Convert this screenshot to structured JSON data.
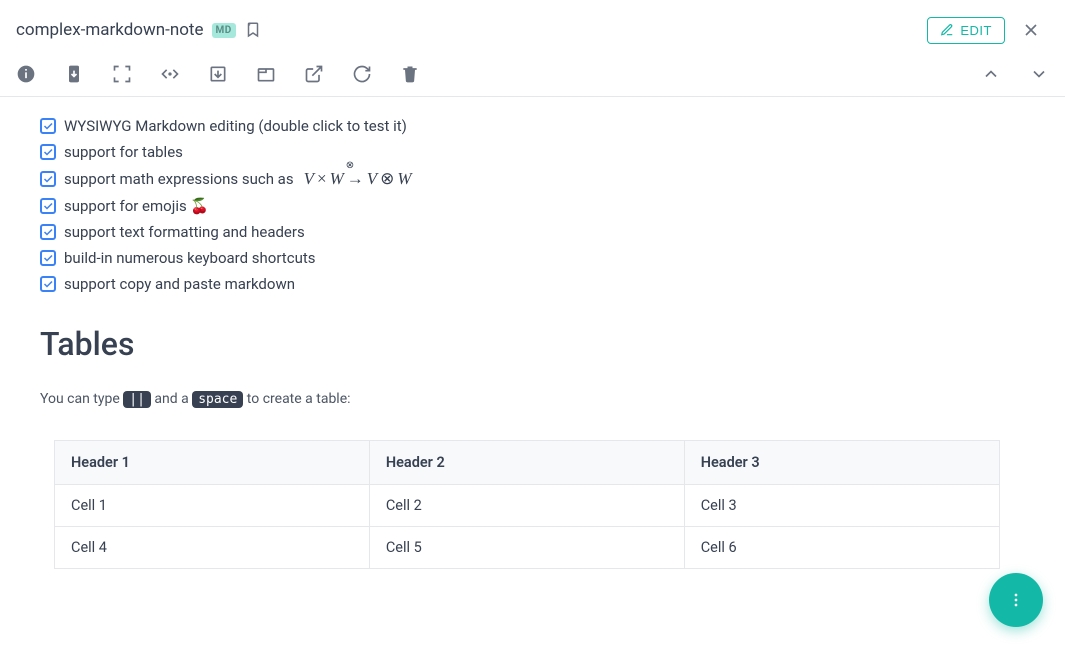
{
  "header": {
    "title": "complex-markdown-note",
    "badge": "MD",
    "edit_label": "EDIT"
  },
  "checklist": {
    "items": [
      "WYSIWYG Markdown editing (double click to test it)",
      "support for tables",
      "support math expressions such as",
      "support for emojis 🍒",
      "support text formatting and headers",
      "build-in numerous keyboard shortcuts",
      "support copy and paste markdown"
    ],
    "math_expr": "V × W → V ⊗ W"
  },
  "tables_section": {
    "heading": "Tables",
    "intro_pre": "You can type ",
    "kbd1": "||",
    "intro_mid": " and a ",
    "kbd2": "space",
    "intro_post": " to create a table:"
  },
  "table": {
    "headers": [
      "Header 1",
      "Header 2",
      "Header 3"
    ],
    "rows": [
      [
        "Cell 1",
        "Cell 2",
        "Cell 3"
      ],
      [
        "Cell 4",
        "Cell 5",
        "Cell 6"
      ]
    ]
  }
}
